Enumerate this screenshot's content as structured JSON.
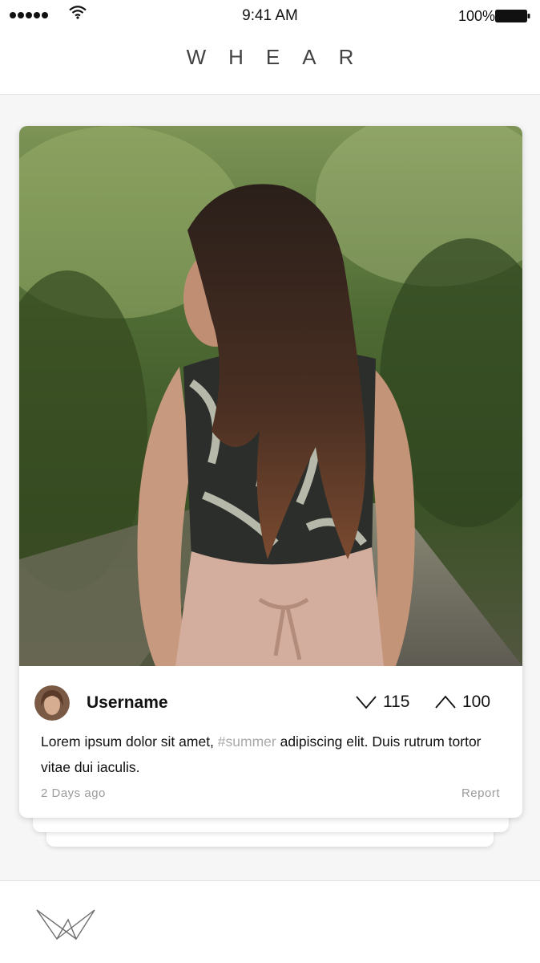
{
  "status_bar": {
    "time": "9:41 AM",
    "battery": "100%",
    "signal_icon": "signal-dots-icon",
    "wifi_icon": "wifi-icon",
    "battery_icon": "battery-icon"
  },
  "header": {
    "title": "WHEAR"
  },
  "post": {
    "image": "photo of woman with long dark hair in palm-print top and blush skirt on jungle path",
    "username": "Username",
    "downvotes": "115",
    "upvotes": "100",
    "caption_before": "Lorem ipsum dolor sit amet, ",
    "hashtag": "#summer",
    "caption_after": " adipiscing elit. Duis rutrum tortor vitae dui iaculis.",
    "posted": "2 Days ago",
    "report_label": "Report",
    "down_icon": "chevron-down-icon",
    "up_icon": "chevron-up-icon"
  },
  "tab_bar": {
    "logo_icon": "whear-logo-icon"
  },
  "colors": {
    "background": "#f6f6f6",
    "card": "#ffffff",
    "hashtag": "#a9a9a9",
    "muted_text": "#9b9b9b"
  }
}
